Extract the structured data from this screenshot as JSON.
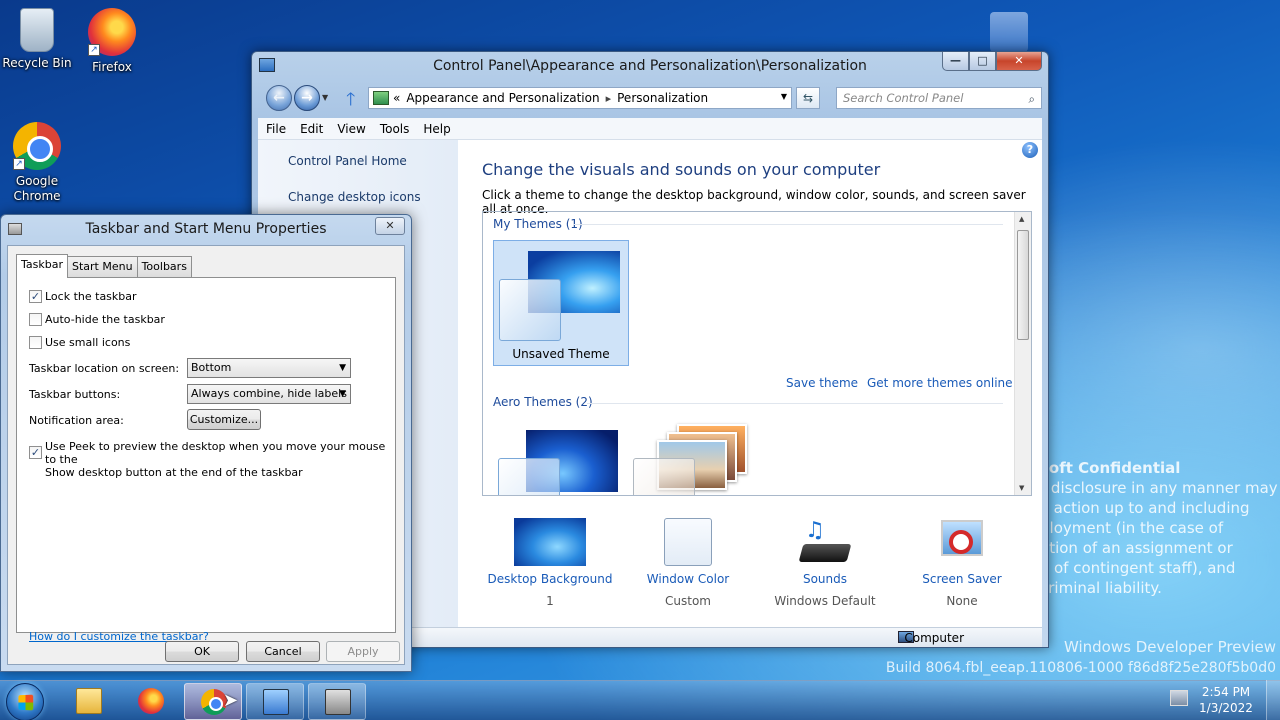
{
  "desktop": {
    "icons": [
      {
        "label": "Recycle Bin",
        "icon": "recycle-bin-icon"
      },
      {
        "label": "Firefox",
        "icon": "firefox-icon"
      },
      {
        "label": "Google Chrome",
        "icon": "chrome-icon"
      }
    ],
    "confidential": {
      "title": "soft Confidential",
      "lines": [
        "r disclosure in any manner may",
        "y action up to and including",
        "ployment (in the case of",
        "ation of an assignment or",
        "e of contingent staff), and",
        "criminal liability."
      ]
    },
    "watermark": {
      "line1": "Windows Developer Preview",
      "line2": "Build 8064.fbl_eeap.110806-1000 f86d8f25e280f5b0d0"
    }
  },
  "control_panel": {
    "title": "Control Panel\\Appearance and Personalization\\Personalization",
    "address": {
      "chevron": "«",
      "crumbs": [
        "Appearance and Personalization",
        "Personalization"
      ]
    },
    "search_placeholder": "Search Control Panel",
    "menu": [
      "File",
      "Edit",
      "View",
      "Tools",
      "Help"
    ],
    "sidebar_links": [
      "Control Panel Home",
      "Change desktop icons"
    ],
    "heading": "Change the visuals and sounds on your computer",
    "subheading": "Click a theme to change the desktop background, window color, sounds, and screen saver all at once.",
    "my_themes_title": "My Themes (1)",
    "selected_theme": "Unsaved Theme",
    "save_theme": "Save theme",
    "more_themes": "Get more themes online",
    "aero_title": "Aero Themes (2)",
    "bottom": [
      {
        "label": "Desktop Background",
        "value": "1"
      },
      {
        "label": "Window Color",
        "value": "Custom"
      },
      {
        "label": "Sounds",
        "value": "Windows Default"
      },
      {
        "label": "Screen Saver",
        "value": "None"
      }
    ],
    "status": "Computer"
  },
  "taskbar_dialog": {
    "title": "Taskbar and Start Menu Properties",
    "tabs": [
      "Taskbar",
      "Start Menu",
      "Toolbars"
    ],
    "active_tab": "Taskbar",
    "lock": {
      "label": "Lock the taskbar",
      "checked": true
    },
    "autohide": {
      "label": "Auto-hide the taskbar",
      "checked": false
    },
    "small_icons": {
      "label": "Use small icons",
      "checked": false
    },
    "location_label": "Taskbar location on screen:",
    "location_value": "Bottom",
    "buttons_label": "Taskbar buttons:",
    "buttons_value": "Always combine, hide labels",
    "notif_label": "Notification area:",
    "customize": "Customize...",
    "peek": {
      "line1": "Use Peek to preview the desktop when you move your mouse to the",
      "line2": "Show desktop button at the end of the taskbar",
      "checked": true
    },
    "help_link": "How do I customize the taskbar?",
    "ok": "OK",
    "cancel": "Cancel",
    "apply": "Apply"
  },
  "taskbar": {
    "time": "2:54 PM",
    "date": "1/3/2022"
  }
}
